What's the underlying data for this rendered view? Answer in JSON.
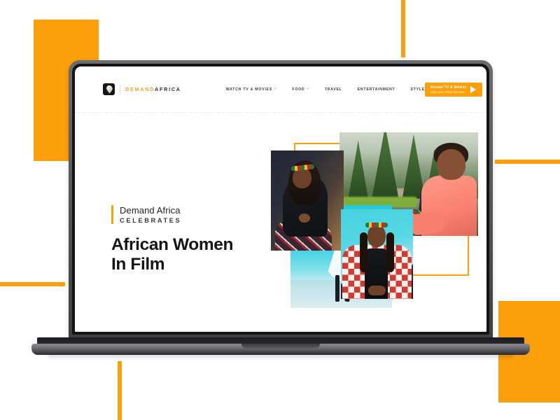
{
  "scene": {
    "device": "laptop-mockup",
    "accent_color": "#fba00b",
    "page_background": "#ffffff",
    "screen_background": "#ffffff"
  },
  "site": {
    "brand": {
      "mark": "demand-africa-logo-icon",
      "word_one": "DEMAND",
      "word_two": "AFRICA"
    },
    "nav": [
      {
        "label": "WATCH TV & MOVIES",
        "caret": "˅",
        "has_dropdown": true
      },
      {
        "label": "FOOD",
        "caret": "˅",
        "has_dropdown": true
      },
      {
        "label": "TRAVEL",
        "caret": "",
        "has_dropdown": false
      },
      {
        "label": "ENTERTAINMENT",
        "caret": "",
        "has_dropdown": false
      },
      {
        "label": "STYLE",
        "caret": "",
        "has_dropdown": false
      }
    ],
    "cta": {
      "line1": "Stream TV & Movies",
      "line2": "Start your FREE trial now",
      "icon": "play-triangle-icon",
      "background": "#fba00b"
    },
    "search": {
      "icon": "search-icon"
    }
  },
  "hero": {
    "eyebrow_top": "Demand Africa",
    "eyebrow_sub": "CELEBRATES",
    "headline_line1": "African Women",
    "headline_line2": "In Film",
    "accent_bar_color": "#fba00b"
  },
  "collage": {
    "frame_color": "#fba00b",
    "photos": [
      {
        "name": "photo-outdoor-coral-top",
        "caption": "Woman in coral top seated outdoors among pine trees"
      },
      {
        "name": "photo-dark-portrait",
        "caption": "Woman with braids and beaded headband in dark top and patterned skirt"
      },
      {
        "name": "photo-dancer-cyan",
        "caption": "Dancer in white dress against turquoise backdrop"
      },
      {
        "name": "photo-checkered-jacket",
        "caption": "Woman in red and white checkered jacket with headband"
      }
    ]
  },
  "decor": {
    "shapes": [
      {
        "name": "orange-square-top-left"
      },
      {
        "name": "orange-square-bottom-right"
      },
      {
        "name": "orange-vertical-bar-top"
      },
      {
        "name": "orange-vertical-bar-bottom"
      },
      {
        "name": "orange-horizontal-bar-left"
      },
      {
        "name": "orange-horizontal-bar-right"
      }
    ]
  }
}
